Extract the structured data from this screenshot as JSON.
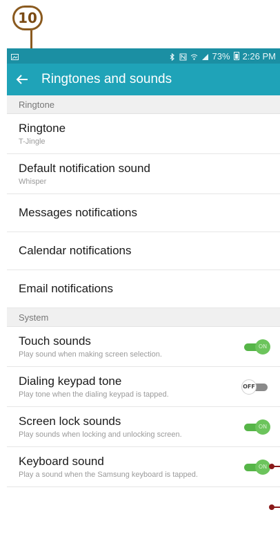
{
  "callout": {
    "number": "10"
  },
  "status_bar": {
    "battery": "73%",
    "time": "2:26 PM"
  },
  "app_bar": {
    "title": "Ringtones and sounds"
  },
  "sections": {
    "ringtone": {
      "header": "Ringtone"
    },
    "system": {
      "header": "System"
    }
  },
  "ringtone_items": [
    {
      "title": "Ringtone",
      "subtitle": "T-Jingle"
    },
    {
      "title": "Default notification sound",
      "subtitle": "Whisper"
    },
    {
      "title": "Messages notifications"
    },
    {
      "title": "Calendar notifications"
    },
    {
      "title": "Email notifications"
    }
  ],
  "system_items": [
    {
      "title": "Touch sounds",
      "subtitle": "Play sound when making screen selection.",
      "toggle": "ON"
    },
    {
      "title": "Dialing keypad tone",
      "subtitle": "Play tone when the dialing keypad is tapped.",
      "toggle": "OFF"
    },
    {
      "title": "Screen lock sounds",
      "subtitle": "Play sounds when locking and unlocking screen.",
      "toggle": "ON"
    },
    {
      "title": "Keyboard sound",
      "subtitle": "Play a sound when the Samsung keyboard is tapped.",
      "toggle": "ON"
    }
  ],
  "colors": {
    "app_bar": "#1fa3b8",
    "status_bar": "#1b8fa3",
    "toggle_on": "#56b548",
    "callout": "#8a5a1f"
  }
}
